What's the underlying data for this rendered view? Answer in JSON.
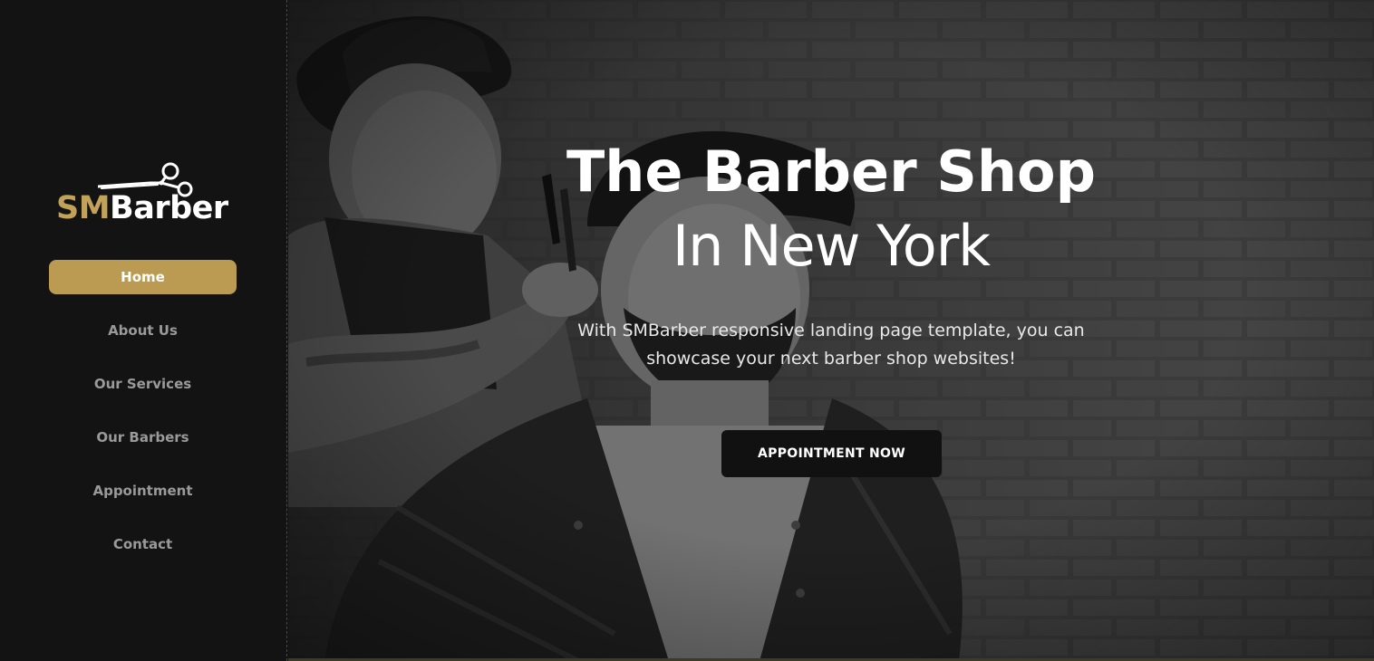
{
  "brand": {
    "name_prefix": "SM",
    "name_suffix": "Barber",
    "accent_color": "#bb9b51"
  },
  "sidebar": {
    "items": [
      {
        "label": "Home",
        "active": true
      },
      {
        "label": "About Us",
        "active": false
      },
      {
        "label": "Our Services",
        "active": false
      },
      {
        "label": "Our Barbers",
        "active": false
      },
      {
        "label": "Appointment",
        "active": false
      },
      {
        "label": "Contact",
        "active": false
      }
    ]
  },
  "hero": {
    "title": "The Barber Shop",
    "subtitle": "In New York",
    "description": "With SMBarber responsive landing page template, you can showcase your next barber shop websites!",
    "cta_label": "APPOINTMENT NOW"
  },
  "icons": {
    "logo_icon": "scissors-icon"
  }
}
